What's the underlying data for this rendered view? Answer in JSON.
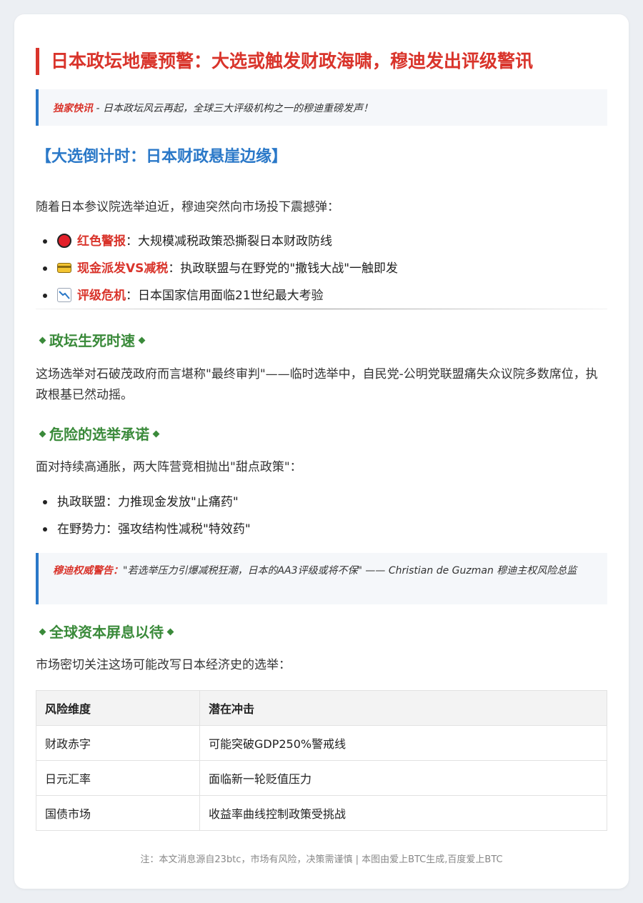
{
  "title": "日本政坛地震预警：大选或触发财政海啸，穆迪发出评级警讯",
  "intro_quote": {
    "label": "独家快讯",
    "text": " - 日本政坛风云再起，全球三大评级机构之一的穆迪重磅发声！"
  },
  "section1": {
    "heading": "【大选倒计时：日本财政悬崖边缘】",
    "lead": "随着日本参议院选举迫近，穆迪突然向市场投下震撼弹：",
    "items": [
      {
        "icon": "red-circle-icon",
        "key": "红色警报",
        "text": "：大规模减税政策恐撕裂日本财政防线"
      },
      {
        "icon": "credit-card-icon",
        "key": "现金派发VS减税",
        "text": "：执政联盟与在野党的\"撒钱大战\"一触即发"
      },
      {
        "icon": "chart-decreasing-icon",
        "key": "评级危机",
        "text": "：日本国家信用面临21世纪最大考验"
      }
    ]
  },
  "section2": {
    "heading": "政坛生死时速",
    "text": "这场选举对石破茂政府而言堪称\"最终审判\"——临时选举中，自民党-公明党联盟痛失众议院多数席位，执政根基已然动摇。"
  },
  "section3": {
    "heading": "危险的选举承诺",
    "lead": "面对持续高通胀，两大阵营竞相抛出\"甜点政策\"：",
    "items": [
      "执政联盟：力推现金发放\"止痛药\"",
      "在野势力：强攻结构性减税\"特效药\""
    ]
  },
  "warning_quote": {
    "label": "穆迪权威警告：",
    "text": "\"若选举压力引爆减税狂潮，日本的AA3评级或将不保\" —— Christian de Guzman 穆迪主权风险总监"
  },
  "section4": {
    "heading": "全球资本屏息以待",
    "lead": "市场密切关注这场可能改写日本经济史的选举：",
    "table": {
      "headers": [
        "风险维度",
        "潜在冲击"
      ],
      "rows": [
        [
          "财政赤字",
          "可能突破GDP250%警戒线"
        ],
        [
          "日元汇率",
          "面临新一轮贬值压力"
        ],
        [
          "国债市场",
          "收益率曲线控制政策受挑战"
        ]
      ]
    }
  },
  "footer": "注：本文消息源自23btc，市场有风险，决策需谨慎 | 本图由爱上BTC生成,百度爱上BTC",
  "colors": {
    "red": "#d9342b",
    "blue": "#2a78c8",
    "green": "#3a8a3a"
  }
}
